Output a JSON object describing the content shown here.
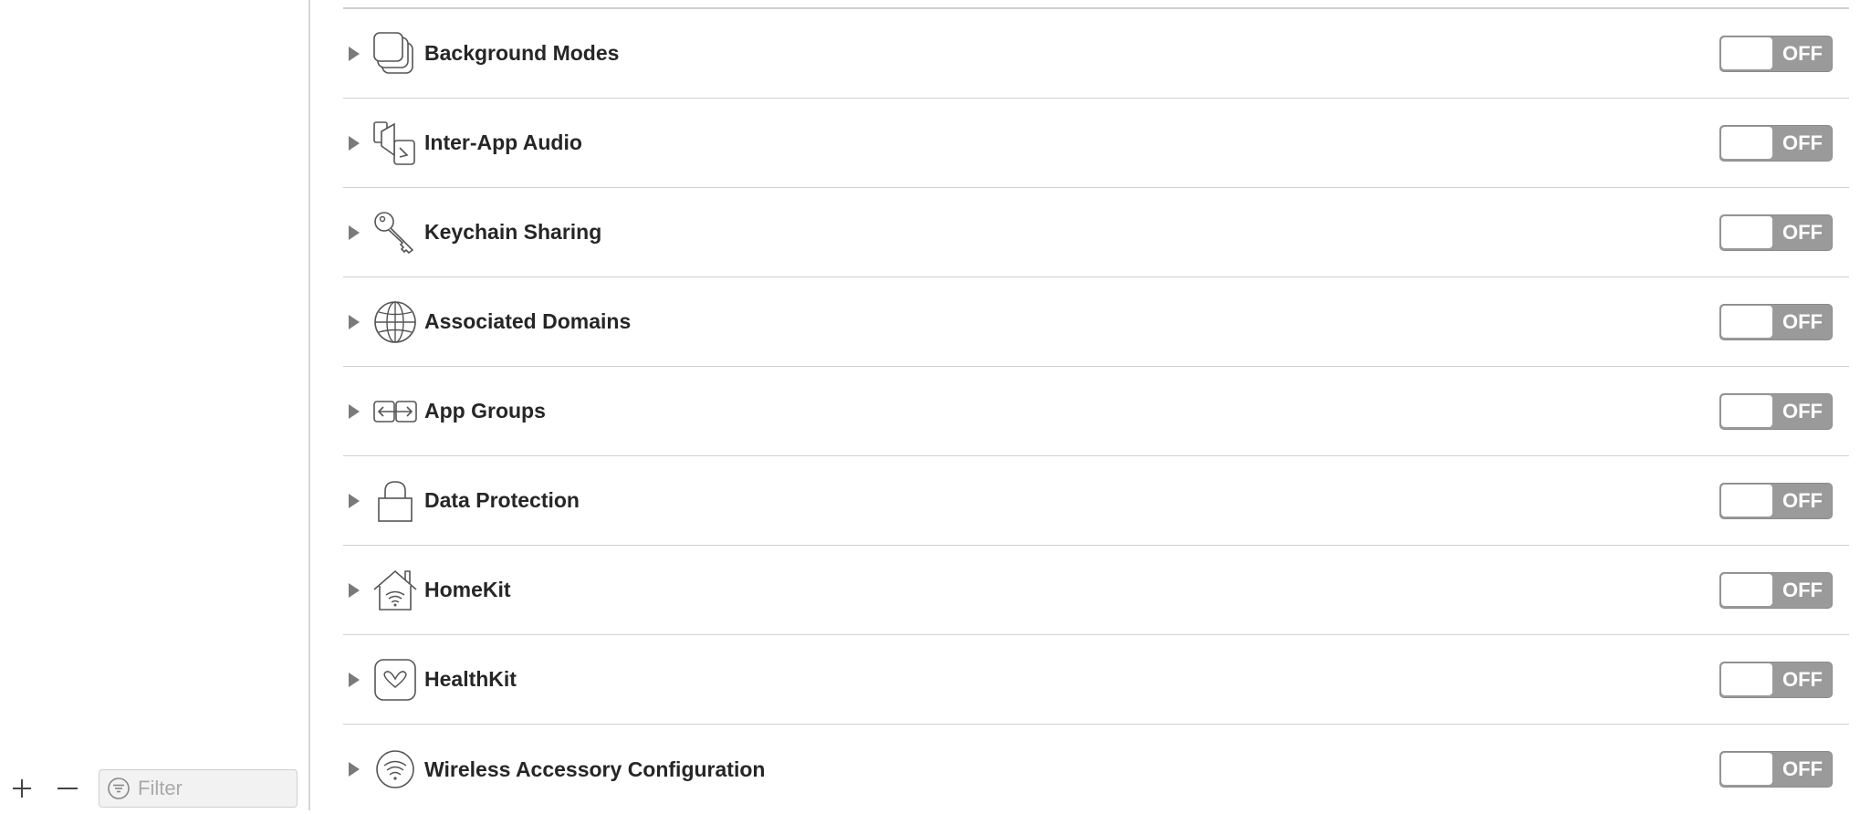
{
  "sidebar": {
    "add_label": "+",
    "remove_label": "—",
    "filter_placeholder": "Filter",
    "filter_value": ""
  },
  "capabilities": [
    {
      "label": "Background Modes",
      "icon": "background-modes-icon",
      "state": "OFF"
    },
    {
      "label": "Inter-App Audio",
      "icon": "inter-app-audio-icon",
      "state": "OFF"
    },
    {
      "label": "Keychain Sharing",
      "icon": "key-icon",
      "state": "OFF"
    },
    {
      "label": "Associated Domains",
      "icon": "globe-icon",
      "state": "OFF"
    },
    {
      "label": "App Groups",
      "icon": "app-groups-icon",
      "state": "OFF"
    },
    {
      "label": "Data Protection",
      "icon": "lock-icon",
      "state": "OFF"
    },
    {
      "label": "HomeKit",
      "icon": "home-icon",
      "state": "OFF"
    },
    {
      "label": "HealthKit",
      "icon": "heart-icon",
      "state": "OFF"
    },
    {
      "label": "Wireless Accessory Configuration",
      "icon": "wireless-icon",
      "state": "OFF"
    }
  ],
  "colors": {
    "toggle_off": "#9a9a9a",
    "row_divider": "#d0d0d0",
    "label": "#262626"
  }
}
